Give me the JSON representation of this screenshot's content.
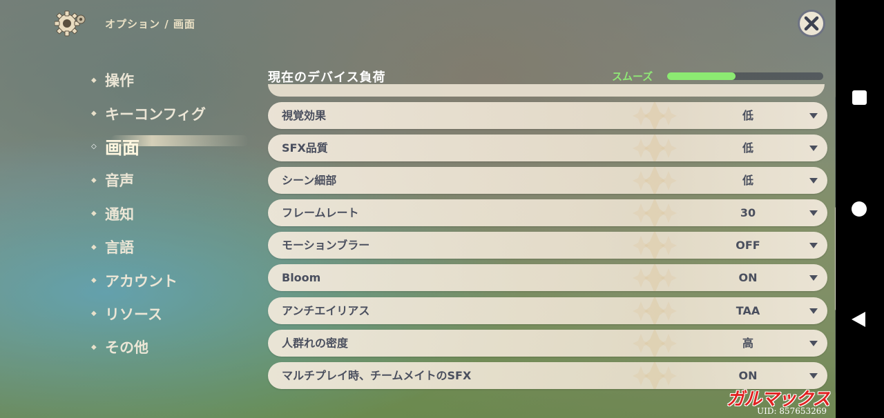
{
  "header": {
    "breadcrumb": "オプション / 画面",
    "gear_icon": "gear-icon",
    "close_icon": "close-icon"
  },
  "menu": {
    "items": [
      {
        "label": "操作",
        "active": false
      },
      {
        "label": "キーコンフィグ",
        "active": false
      },
      {
        "label": "画面",
        "active": true
      },
      {
        "label": "音声",
        "active": false
      },
      {
        "label": "通知",
        "active": false
      },
      {
        "label": "言語",
        "active": false
      },
      {
        "label": "アカウント",
        "active": false
      },
      {
        "label": "リソース",
        "active": false
      },
      {
        "label": "その他",
        "active": false
      }
    ]
  },
  "device_load": {
    "title": "現在のデバイス負荷",
    "status": "スムーズ",
    "level": 0.44,
    "color": "#8cea72"
  },
  "settings": [
    {
      "label": "視覚効果",
      "value": "低"
    },
    {
      "label": "SFX品質",
      "value": "低"
    },
    {
      "label": "シーン細部",
      "value": "低"
    },
    {
      "label": "フレームレート",
      "value": "30"
    },
    {
      "label": "モーションブラー",
      "value": "OFF"
    },
    {
      "label": "Bloom",
      "value": "ON"
    },
    {
      "label": "アンチエイリアス",
      "value": "TAA"
    },
    {
      "label": "人群れの密度",
      "value": "高"
    },
    {
      "label": "マルチプレイ時、チームメイトのSFX",
      "value": "ON"
    }
  ],
  "watermark": {
    "logo": "ガルマックス",
    "uid": "UID: 857653269"
  },
  "android_nav": [
    "recents-icon",
    "home-icon",
    "back-icon"
  ]
}
